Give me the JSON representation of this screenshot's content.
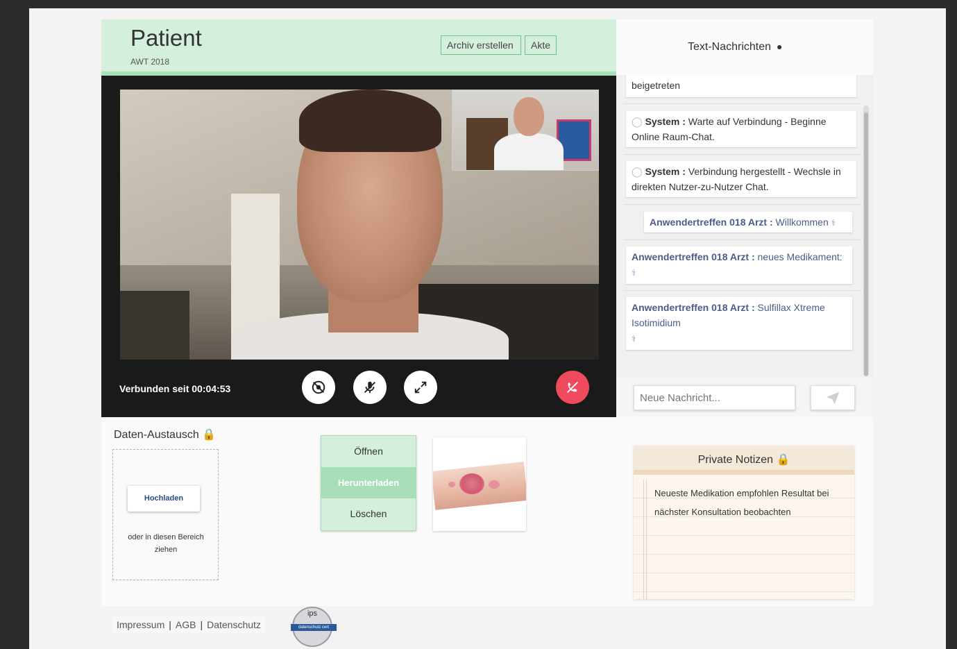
{
  "patient": {
    "title": "Patient",
    "subtitle": "AWT 2018",
    "archive_button": "Archiv erstellen",
    "record_button": "Akte"
  },
  "video": {
    "status": "Verbunden seit 00:04:53",
    "controls": {
      "camera": "camera-off-icon",
      "mic": "mic-off-icon",
      "fullscreen": "fullscreen-icon",
      "hangup": "hangup-icon"
    },
    "hangup_color": "#ef4a5d"
  },
  "chat": {
    "title": "Text-Nachrichten",
    "messages": [
      {
        "sender": "",
        "text": "beigetreten"
      },
      {
        "sender": "System :",
        "text": " Warte auf Verbindung - Beginne Online Raum-Chat."
      },
      {
        "sender": "System :",
        "text": " Verbindung hergestellt - Wechsle in direkten Nutzer-zu-Nutzer Chat."
      },
      {
        "sender": "Anwendertreffen 018 Arzt :",
        "text": " Willkommen"
      },
      {
        "sender": "Anwendertreffen 018 Arzt :",
        "text": " neues Medikament:"
      },
      {
        "sender": "Anwendertreffen 018 Arzt :",
        "text": " Sulfillax Xtreme Isotimidium"
      }
    ],
    "input_placeholder": "Neue Nachricht..."
  },
  "data_exchange": {
    "title": "Daten-Austausch",
    "upload_button": "Hochladen",
    "drop_hint": "oder in diesen Bereich ziehen",
    "actions": [
      "Öffnen",
      "Herunterladen",
      "Löschen"
    ],
    "active_action_index": 1
  },
  "notes": {
    "title": "Private Notizen",
    "text": "Neueste Medikation empfohlen Resultat bei nächster Konsultation beobachten"
  },
  "footer": {
    "links": [
      "Impressum",
      "AGB",
      "Datenschutz"
    ],
    "badge_top": "ips",
    "badge_band": "datenschutz cert"
  },
  "colors": {
    "accent_green": "#d4f0dc",
    "doctor_text": "#4b5c8a"
  }
}
